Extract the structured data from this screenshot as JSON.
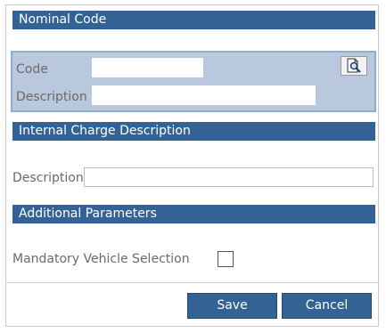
{
  "nominal_code": {
    "header": "Nominal Code",
    "code_label": "Code",
    "code_value": "",
    "description_label": "Description",
    "description_value": "",
    "lookup_icon": "search-document-icon"
  },
  "internal_charge": {
    "header": "Internal Charge Description",
    "description_label": "Description",
    "description_value": ""
  },
  "additional_parameters": {
    "header": "Additional Parameters",
    "mandatory_vehicle_label": "Mandatory Vehicle Selection",
    "mandatory_vehicle_checked": false
  },
  "actions": {
    "save_label": "Save",
    "cancel_label": "Cancel"
  },
  "colors": {
    "header_bg": "#336294",
    "group_bg": "#b9c8dc",
    "group_border": "#8eaed3"
  }
}
